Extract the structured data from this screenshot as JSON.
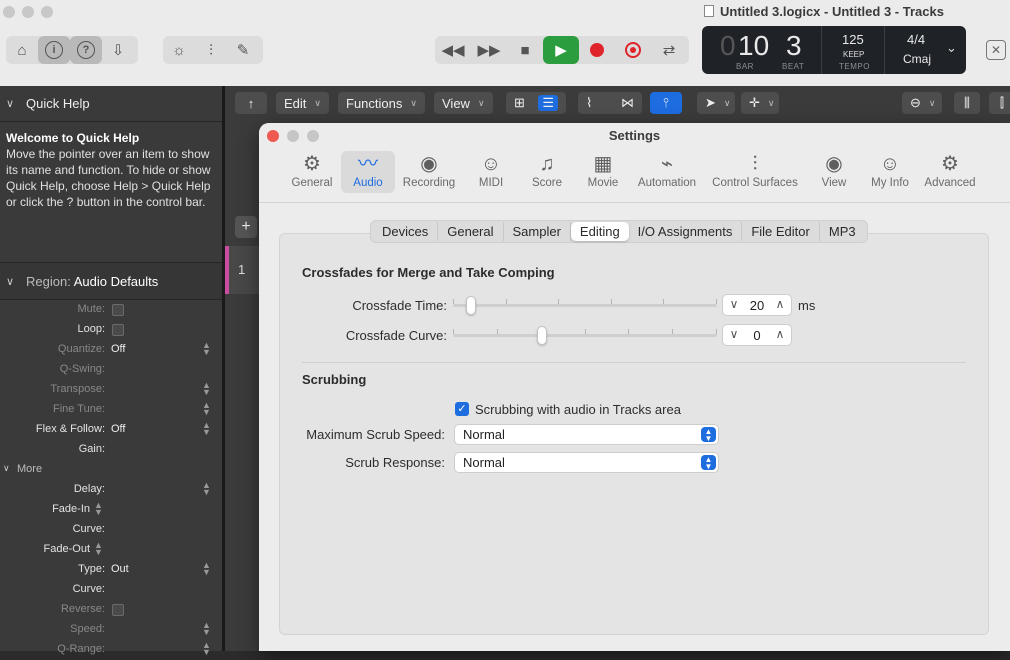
{
  "window": {
    "title": "Untitled 3.logicx - Untitled 3 - Tracks"
  },
  "lcd": {
    "bar": "10",
    "bar_lead": "0",
    "beat": "3",
    "bar_label": "BAR",
    "beat_label": "BEAT",
    "tempo": "125",
    "tempo_mode": "KEEP",
    "tempo_label": "TEMPO",
    "signature": "4/4",
    "key": "Cmaj"
  },
  "quick_help": {
    "header": "Quick Help",
    "title": "Welcome to Quick Help",
    "body": "Move the pointer over an item to show its name and function. To hide or show Quick Help, choose Help > Quick Help or click the ? button in the control bar."
  },
  "region": {
    "header_prefix": "Region:",
    "header_name": "Audio Defaults",
    "more_label": "More",
    "properties": [
      {
        "label": "Mute:",
        "value": "",
        "checkbox": true,
        "stepper": false,
        "on": false
      },
      {
        "label": "Loop:",
        "value": "",
        "checkbox": true,
        "stepper": false,
        "on": true
      },
      {
        "label": "Quantize:",
        "value": "Off",
        "checkbox": false,
        "stepper": true,
        "on": false
      },
      {
        "label": "Q-Swing:",
        "value": "",
        "checkbox": false,
        "stepper": false,
        "on": false
      },
      {
        "label": "Transpose:",
        "value": "",
        "checkbox": false,
        "stepper": true,
        "on": false
      },
      {
        "label": "Fine Tune:",
        "value": "",
        "checkbox": false,
        "stepper": true,
        "on": false
      },
      {
        "label": "Flex & Follow:",
        "value": "Off",
        "checkbox": false,
        "stepper": true,
        "on": true
      },
      {
        "label": "Gain:",
        "value": "",
        "checkbox": false,
        "stepper": false,
        "on": true
      }
    ],
    "more_properties": [
      {
        "label": "Delay:",
        "value": "",
        "checkbox": false,
        "stepper": true,
        "on": true
      },
      {
        "label": "Fade-In",
        "value": "",
        "checkbox": false,
        "stepper": false,
        "on": true,
        "inline_stepper": true
      },
      {
        "label": "Curve:",
        "value": "",
        "checkbox": false,
        "stepper": false,
        "on": true
      },
      {
        "label": "Fade-Out",
        "value": "",
        "checkbox": false,
        "stepper": false,
        "on": true,
        "inline_stepper": true
      },
      {
        "label": "Type:",
        "value": "Out",
        "checkbox": false,
        "stepper": true,
        "on": true
      },
      {
        "label": "Curve:",
        "value": "",
        "checkbox": false,
        "stepper": false,
        "on": true
      },
      {
        "label": "Reverse:",
        "value": "",
        "checkbox": true,
        "stepper": false,
        "on": false
      },
      {
        "label": "Speed:",
        "value": "",
        "checkbox": false,
        "stepper": true,
        "on": false
      },
      {
        "label": "Q-Range:",
        "value": "",
        "checkbox": false,
        "stepper": true,
        "on": false
      }
    ]
  },
  "tracks_toolbar": {
    "edit": "Edit",
    "functions": "Functions",
    "view": "View"
  },
  "track": {
    "number": "1"
  },
  "settings": {
    "title": "Settings",
    "panes": [
      {
        "label": "General",
        "icon": "gear-icon"
      },
      {
        "label": "Audio",
        "icon": "waveform-icon"
      },
      {
        "label": "Recording",
        "icon": "record-icon"
      },
      {
        "label": "MIDI",
        "icon": "midi-port-icon"
      },
      {
        "label": "Score",
        "icon": "notes-icon"
      },
      {
        "label": "Movie",
        "icon": "film-icon"
      },
      {
        "label": "Automation",
        "icon": "automation-icon"
      },
      {
        "label": "Control Surfaces",
        "icon": "faders-icon"
      },
      {
        "label": "View",
        "icon": "eye-icon"
      },
      {
        "label": "My Info",
        "icon": "person-icon"
      },
      {
        "label": "Advanced",
        "icon": "gears-icon"
      }
    ],
    "active_pane": "Audio",
    "tabs": [
      "Devices",
      "General",
      "Sampler",
      "Editing",
      "I/O Assignments",
      "File Editor",
      "MP3"
    ],
    "active_tab": "Editing",
    "crossfades": {
      "heading": "Crossfades for Merge and Take Comping",
      "time_label": "Crossfade Time:",
      "time_value": "20",
      "time_unit": "ms",
      "time_fraction": 0.05,
      "curve_label": "Crossfade Curve:",
      "curve_value": "0",
      "curve_fraction": 0.33
    },
    "scrubbing": {
      "heading": "Scrubbing",
      "checkbox_label": "Scrubbing with audio in Tracks area",
      "checkbox_checked": true,
      "max_speed_label": "Maximum Scrub Speed:",
      "max_speed_value": "Normal",
      "response_label": "Scrub Response:",
      "response_value": "Normal"
    }
  },
  "colors": {
    "accent": "#1d6ce0",
    "play": "#2b9d3f",
    "record": "#e0242b",
    "close": "#ee5a52",
    "track_color": "#c94ca0"
  }
}
